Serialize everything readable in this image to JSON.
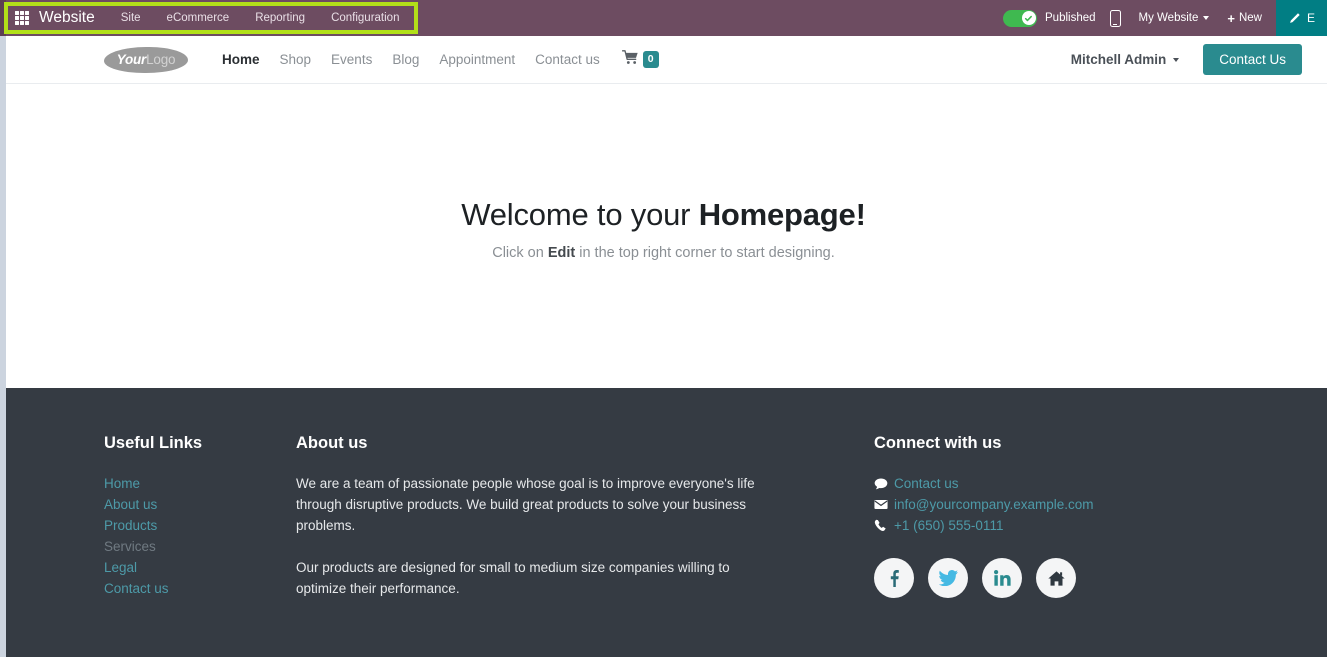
{
  "systray": {
    "apps_icon": "apps-grid-icon",
    "app_name": "Website",
    "menus": [
      "Site",
      "eCommerce",
      "Reporting",
      "Configuration"
    ],
    "published_label": "Published",
    "mobile_icon": "mobile-preview-icon",
    "website_selector": "My Website",
    "new_label": "New",
    "edit_label": "E",
    "highlight_color": "#b2e019",
    "bar_color": "#6d4c61",
    "toggle_on_color": "#3fb950",
    "edit_button_color": "#017e84"
  },
  "site_header": {
    "logo_primary": "Your",
    "logo_secondary": "Logo",
    "nav": [
      {
        "label": "Home",
        "active": true
      },
      {
        "label": "Shop",
        "active": false
      },
      {
        "label": "Events",
        "active": false
      },
      {
        "label": "Blog",
        "active": false
      },
      {
        "label": "Appointment",
        "active": false
      },
      {
        "label": "Contact us",
        "active": false
      }
    ],
    "cart_count": "0",
    "user_name": "Mitchell Admin",
    "cta_label": "Contact Us",
    "accent_color": "#2a8b8f"
  },
  "hero": {
    "title_plain": "Welcome to your ",
    "title_bold": "Homepage!",
    "sub_before": "Click on ",
    "sub_bold": "Edit",
    "sub_after": " in the top right corner to start designing."
  },
  "footer": {
    "background": "#353b43",
    "link_color": "#4d9aa8",
    "useful_links": {
      "heading": "Useful Links",
      "items": [
        {
          "label": "Home",
          "muted": false
        },
        {
          "label": "About us",
          "muted": false
        },
        {
          "label": "Products",
          "muted": false
        },
        {
          "label": "Services",
          "muted": true
        },
        {
          "label": "Legal",
          "muted": false
        },
        {
          "label": "Contact us",
          "muted": false
        }
      ]
    },
    "about": {
      "heading": "About us",
      "paragraph_1": "We are a team of passionate people whose goal is to improve everyone's life through disruptive products. We build great products to solve your business problems.",
      "paragraph_2": "Our products are designed for small to medium size companies willing to optimize their performance."
    },
    "connect": {
      "heading": "Connect with us",
      "items": [
        {
          "icon": "comment-icon",
          "label": "Contact us"
        },
        {
          "icon": "envelope-icon",
          "label": "info@yourcompany.example.com"
        },
        {
          "icon": "phone-icon",
          "label": "+1 (650) 555-0111"
        }
      ],
      "socials": [
        {
          "icon": "facebook-icon",
          "color": "#2a6b77"
        },
        {
          "icon": "twitter-icon",
          "color": "#45b9e3"
        },
        {
          "icon": "linkedin-icon",
          "color": "#2a8b8f"
        },
        {
          "icon": "home-icon",
          "color": "#2f3840"
        }
      ]
    }
  }
}
